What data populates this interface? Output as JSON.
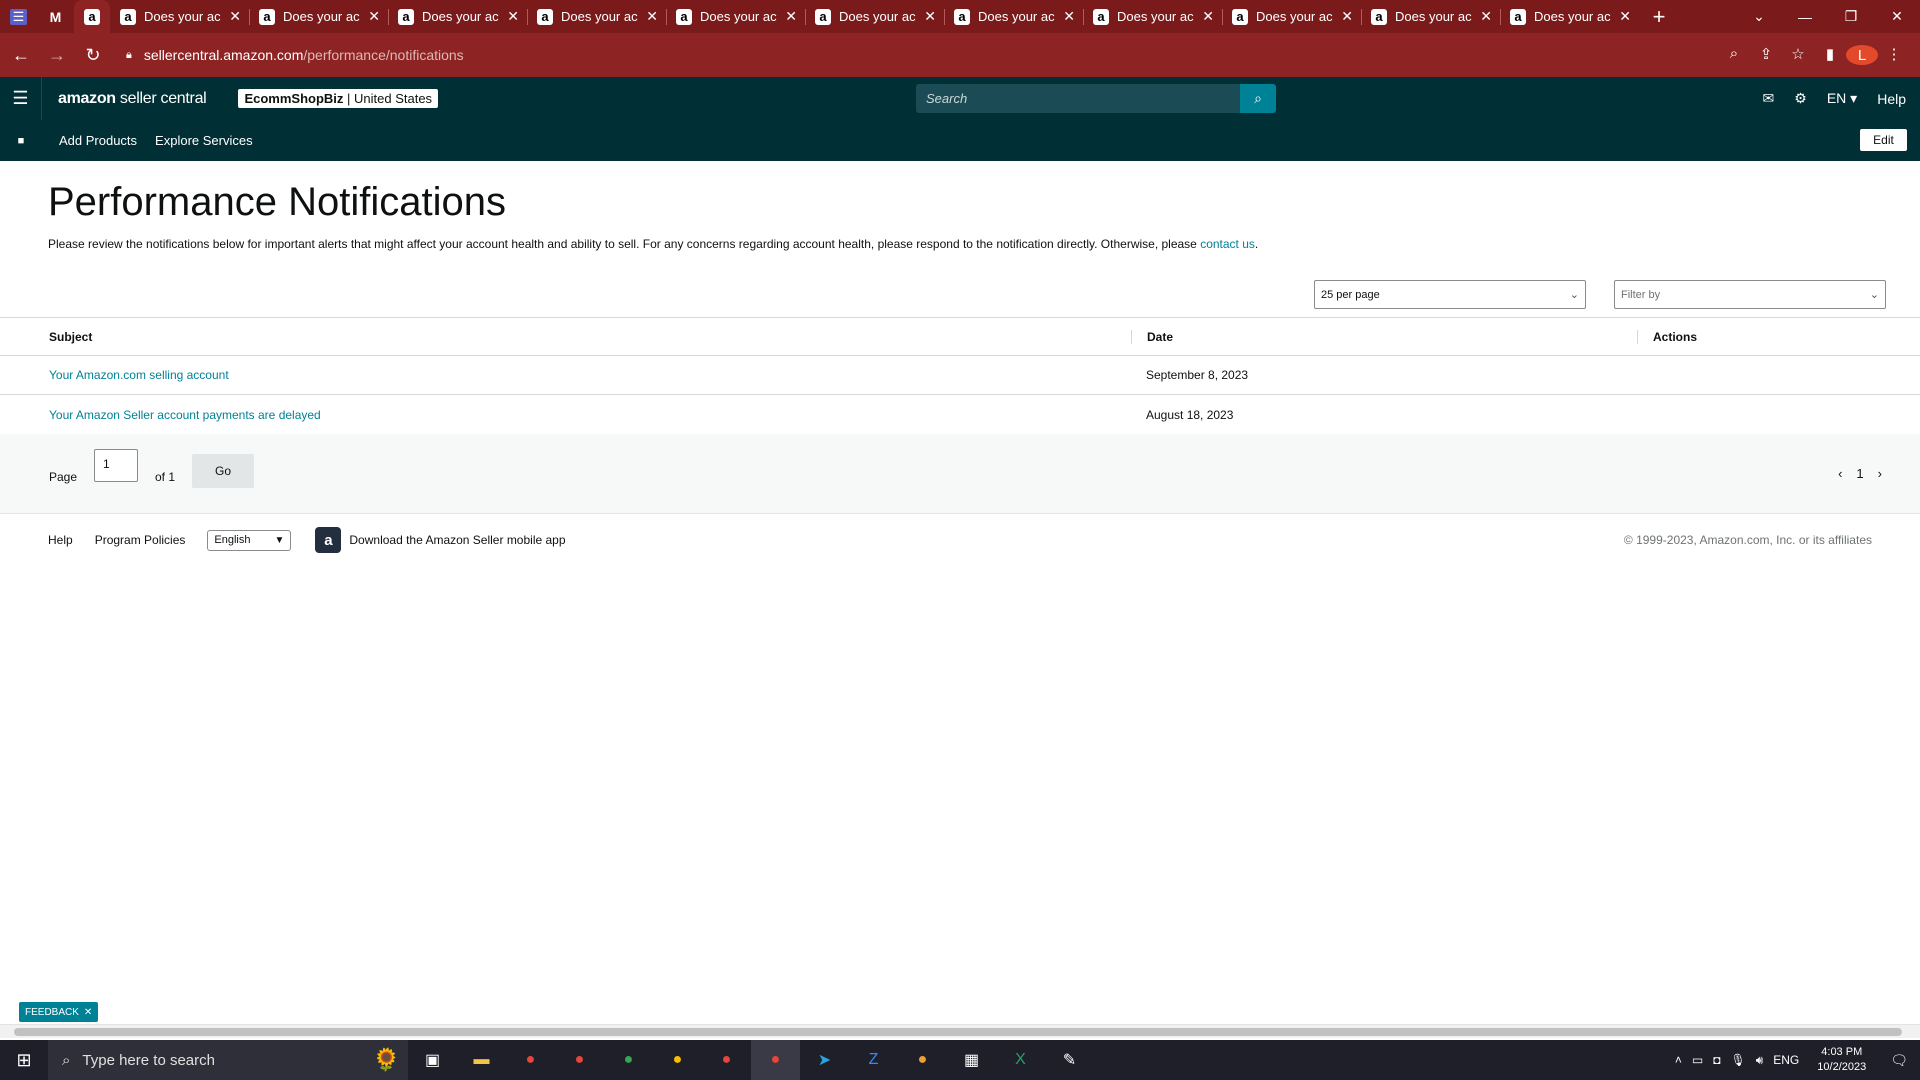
{
  "browser": {
    "tabs": [
      {
        "title": "Does your ac",
        "close": "✕"
      },
      {
        "title": "Does your ac",
        "close": "✕"
      },
      {
        "title": "Does your ac",
        "close": "✕"
      },
      {
        "title": "Does your ac",
        "close": "✕"
      },
      {
        "title": "Does your ac",
        "close": "✕"
      },
      {
        "title": "Does your ac",
        "close": "✕"
      },
      {
        "title": "Does your ac",
        "close": "✕"
      },
      {
        "title": "Does your ac",
        "close": "✕"
      },
      {
        "title": "Does your ac",
        "close": "✕"
      },
      {
        "title": "Does your ac",
        "close": "✕"
      },
      {
        "title": "Does your ac",
        "close": "✕"
      }
    ],
    "new_tab": "+",
    "url_host": "sellercentral.amazon.com",
    "url_path": "/performance/notifications",
    "profile_initial": "L"
  },
  "header": {
    "logo_bold": "amazon",
    "logo_thin": " seller central",
    "store_name": "EcommShopBiz",
    "store_region": " | United States",
    "search_placeholder": "Search",
    "language": "EN ▾",
    "help": "Help"
  },
  "subnav": {
    "items": [
      "Add Products",
      "Explore Services"
    ],
    "edit": "Edit"
  },
  "page": {
    "title": "Performance Notifications",
    "description": "Please review the notifications below for important alerts that might affect your account health and ability to sell. For any concerns regarding account health, please respond to the notification directly. Otherwise, please ",
    "contact_link": "contact us",
    "per_page": "25 per page",
    "filter_placeholder": "Filter by"
  },
  "table": {
    "columns": [
      "Subject",
      "Date",
      "Actions"
    ],
    "rows": [
      {
        "subject": "Your Amazon.com selling account",
        "date": "September 8, 2023"
      },
      {
        "subject": "Your Amazon Seller account payments are delayed",
        "date": "August 18, 2023"
      }
    ]
  },
  "pager": {
    "label": "Page",
    "current": "1",
    "of": "of 1",
    "go": "Go",
    "page_number": "1"
  },
  "footer": {
    "help": "Help",
    "policies": "Program Policies",
    "language": "English",
    "app": "Download the Amazon Seller mobile app",
    "copyright": "© 1999-2023, Amazon.com, Inc. or its affiliates"
  },
  "feedback": {
    "label": "FEEDBACK",
    "close": "✕"
  },
  "taskbar": {
    "search_placeholder": "Type here to search",
    "lang": "ENG",
    "time": "4:03 PM",
    "date": "10/2/2023"
  },
  "colors": {
    "header_bg": "#002f36",
    "link": "#008296",
    "browser_frame": "#8e2323"
  }
}
